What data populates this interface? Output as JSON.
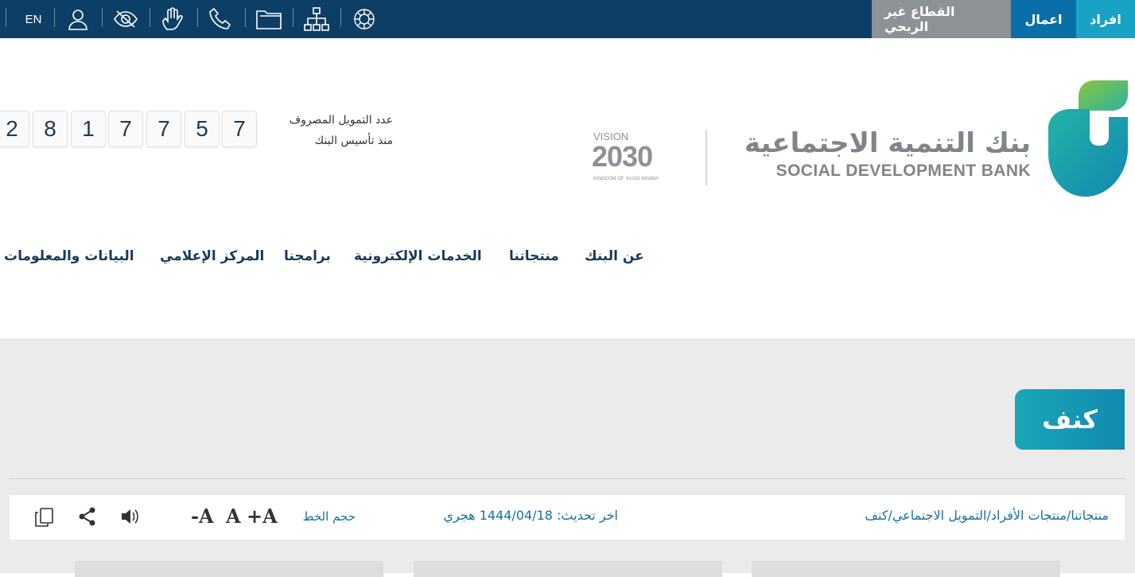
{
  "topbar": {
    "segments": {
      "individuals": "افراد",
      "business": "اعمال",
      "nonprofit": "القطاع غير الربحي"
    },
    "lang": "EN",
    "icons": [
      "user-icon",
      "eye-off-icon",
      "sign-language-icon",
      "phone-icon",
      "folder-icon",
      "sitemap-icon",
      "emblem-icon"
    ]
  },
  "header": {
    "bank_name_ar": "بنك التنمية الاجتماعية",
    "bank_name_en": "SOCIAL DEVELOPMENT BANK",
    "vision": {
      "top": "VISION",
      "year": "2030",
      "sub": "KINGDOM OF SAUDI ARABIA"
    },
    "counter_label_line1": "عدد التمويل المصروف",
    "counter_label_line2": "منذ تأسيس البنك",
    "counter_digits": [
      "2",
      "8",
      "1",
      "7",
      "7",
      "5",
      "7"
    ]
  },
  "nav": {
    "items": [
      "عن البنك",
      "منتجاتنا",
      "الخدمات الإلكترونية",
      "برامجنا",
      "المركز الإعلامي",
      "البيانات والمعلومات"
    ]
  },
  "page": {
    "title": "كنف",
    "breadcrumb": "منتجاتنا/منتجات الأفراد/التمويل الاجتماعي/كنف",
    "updated": "اخر تحديث: 1444/04/18 هجري",
    "font_size_label": "حجم الخط",
    "font_plus": "+A",
    "font_normal": "A",
    "font_minus": "-A"
  },
  "colors": {
    "topbar": "#0d3f66",
    "individuals": "#18a3c4",
    "business": "#0a6ea8",
    "nonprofit": "#8d9297",
    "accent": "#1a6fa0"
  }
}
